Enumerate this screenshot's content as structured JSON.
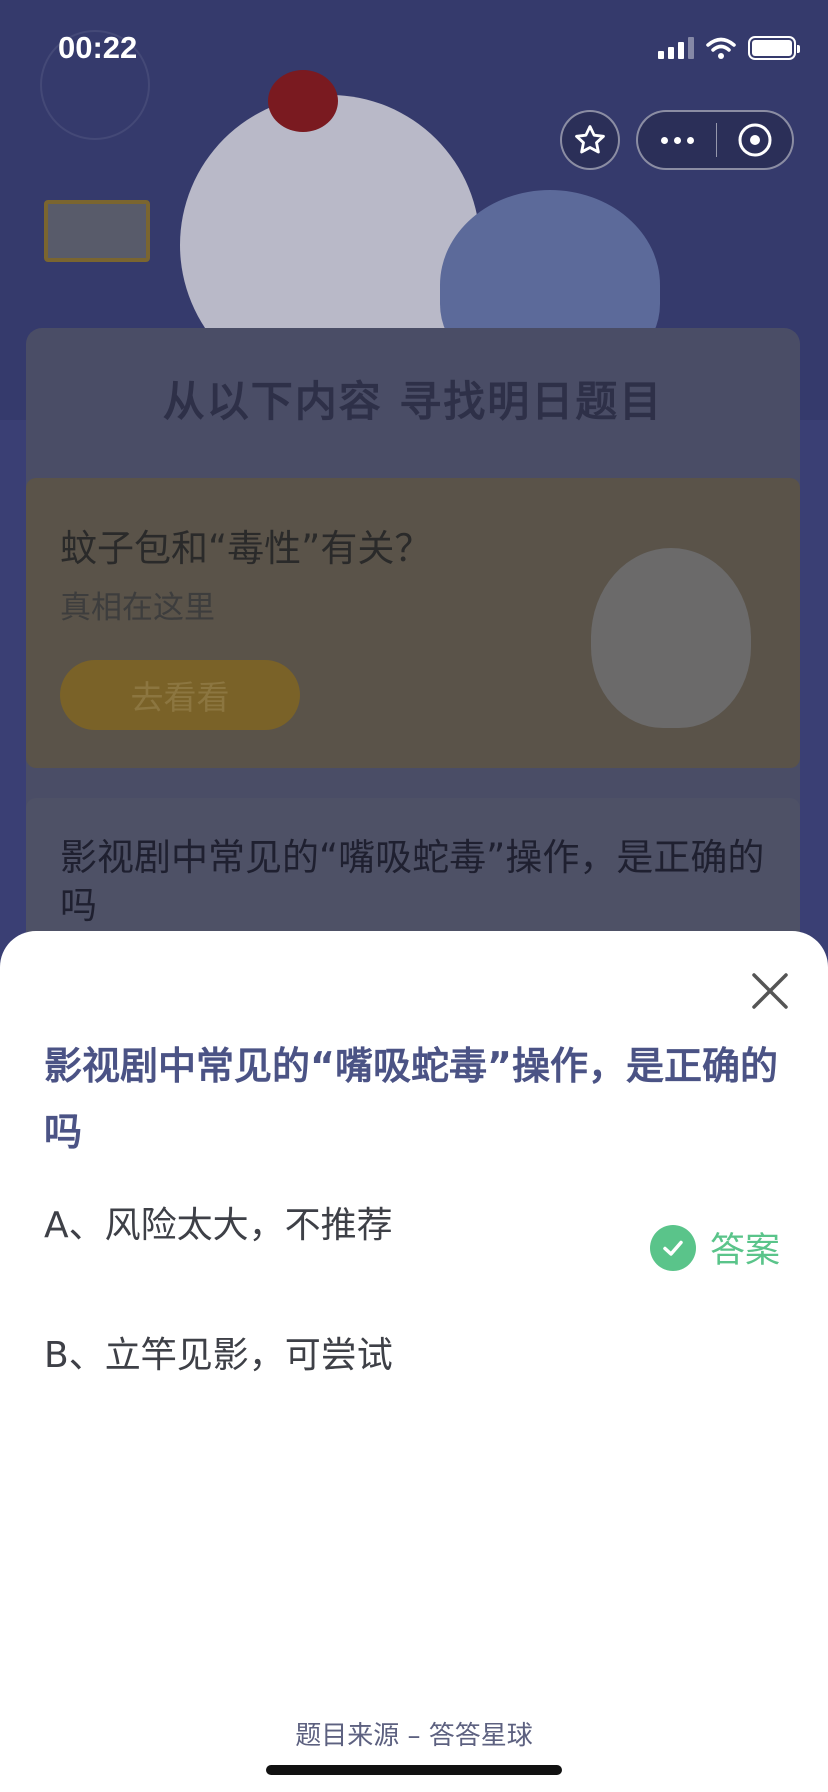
{
  "status_bar": {
    "time": "00:22"
  },
  "capsule": {
    "star_icon": "star-icon",
    "more_icon": "more-dots-icon",
    "close_icon": "close-circle-icon"
  },
  "background": {
    "card_title": "从以下内容 寻找明日题目",
    "promo": {
      "question": "蚊子包和“毒性”有关？",
      "subtitle": "真相在这里",
      "button": "去看看"
    },
    "question_card": {
      "text": "影视剧中常见的“嘴吸蛇毒”操作，是正确的吗"
    }
  },
  "sheet": {
    "close_icon": "close-x-icon",
    "question": "影视剧中常见的“嘴吸蛇毒”操作，是正确的吗",
    "options": [
      {
        "label": "A、风险太大，不推荐",
        "is_answer": true
      },
      {
        "label": "B、立竿见影，可尝试",
        "is_answer": false
      }
    ],
    "answer_label": "答案",
    "source": "题目来源 – 答答星球"
  },
  "colors": {
    "accent_green": "#5ac48a",
    "question_blue": "#4b5385"
  }
}
